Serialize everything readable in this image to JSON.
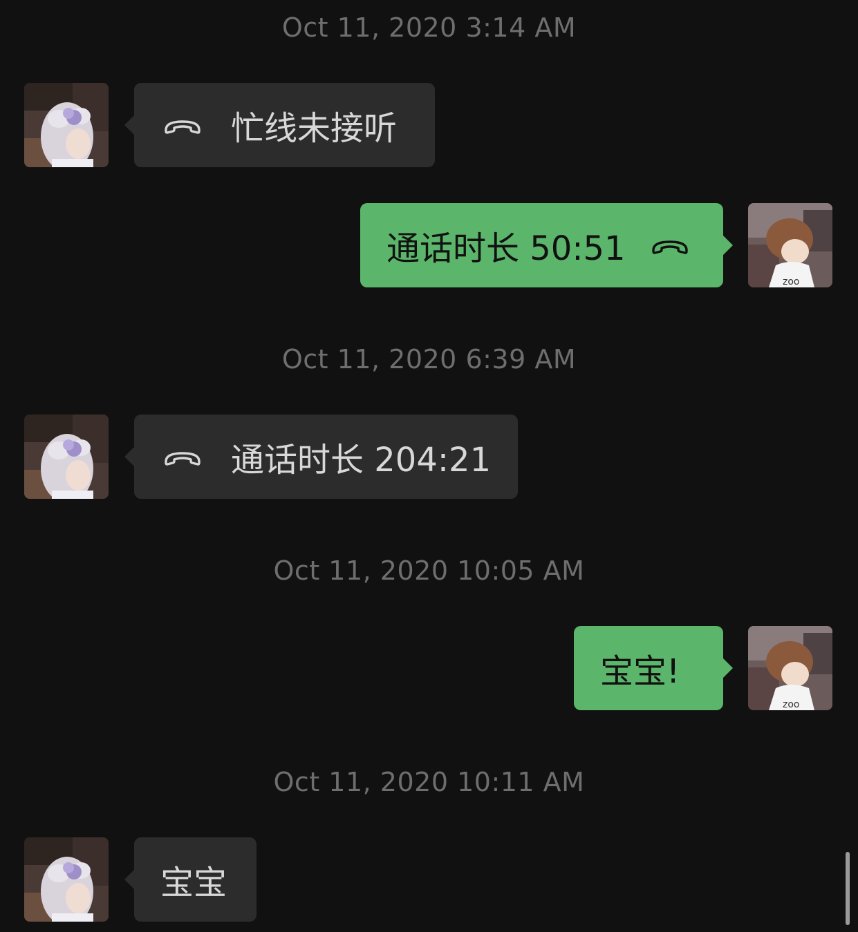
{
  "colors": {
    "background": "#111111",
    "incoming_bubble": "#2c2c2c",
    "outgoing_bubble": "#5bb56a",
    "timestamp_text": "#6e6e6e"
  },
  "messages": [
    {
      "kind": "timestamp",
      "text": "Oct 11, 2020 3:14 AM"
    },
    {
      "kind": "message",
      "direction": "incoming",
      "type": "call",
      "icon": "phone-hangup-icon",
      "text": "忙线未接听"
    },
    {
      "kind": "message",
      "direction": "outgoing",
      "type": "call",
      "icon": "phone-hangup-icon",
      "text": "通话时长 50:51"
    },
    {
      "kind": "timestamp",
      "text": "Oct 11, 2020 6:39 AM"
    },
    {
      "kind": "message",
      "direction": "incoming",
      "type": "call",
      "icon": "phone-hangup-icon",
      "text": "通话时长 204:21"
    },
    {
      "kind": "timestamp",
      "text": "Oct 11, 2020 10:05 AM"
    },
    {
      "kind": "message",
      "direction": "outgoing",
      "type": "text",
      "text": "宝宝!"
    },
    {
      "kind": "timestamp",
      "text": "Oct 11, 2020 10:11 AM"
    },
    {
      "kind": "message",
      "direction": "incoming",
      "type": "text",
      "text": "宝宝"
    }
  ]
}
